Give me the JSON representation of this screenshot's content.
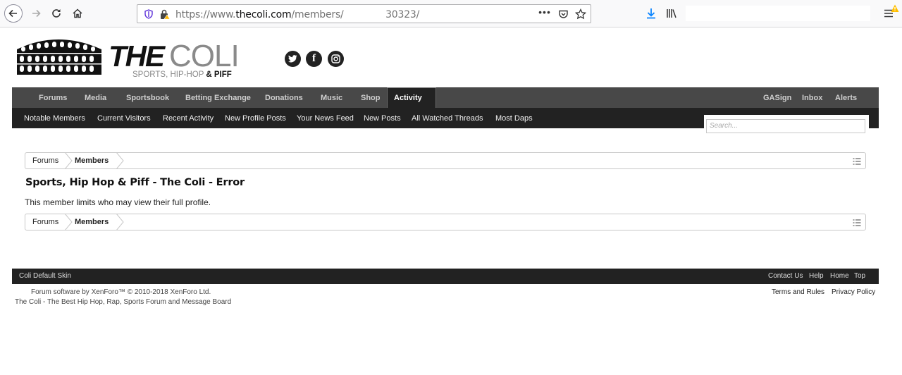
{
  "browser": {
    "url_prefix": "https://www.",
    "url_domain": "thecoli.com",
    "url_path": "/members/",
    "url_suffix": "30323/",
    "page_actions": "•••"
  },
  "site": {
    "logo_text": "THE COLI",
    "logo_the": "THE",
    "logo_coli": "COLI",
    "logo_sub": "SPORTS, HIP-HOP",
    "logo_piff": "& PIFF",
    "social": [
      "twitter-icon",
      "facebook-icon",
      "instagram-icon"
    ],
    "facebook_glyph": "f"
  },
  "nav": {
    "tabs": [
      "Forums",
      "Media",
      "Sportsbook",
      "Betting Exchange",
      "Donations",
      "Music",
      "Shop",
      "Activity"
    ],
    "active_tab": "Activity",
    "right": [
      "GASign",
      "Inbox",
      "Alerts"
    ],
    "sub": [
      "Notable Members",
      "Current Visitors",
      "Recent Activity",
      "New Profile Posts",
      "Your News Feed",
      "New Posts",
      "All Watched Threads",
      "Most Daps"
    ]
  },
  "search": {
    "placeholder": "Search..."
  },
  "breadcrumb": {
    "forums": "Forums",
    "members": "Members"
  },
  "error": {
    "title": "Sports, Hip Hop & Piff - The Coli - Error",
    "message": "This member limits who may view their full profile."
  },
  "footer": {
    "skin": "Coli Default Skin",
    "links": [
      "Contact Us",
      "Help",
      "Home",
      "Top"
    ],
    "copyright": "Forum software by XenForo™ © 2010-2018 XenForo Ltd.",
    "tagline": "The Coli - The Best Hip Hop, Rap, Sports Forum and Message Board",
    "terms": "Terms and Rules",
    "privacy": "Privacy Policy"
  },
  "colors": {
    "navbar": "#484848",
    "subnav": "#222222",
    "footer": "#222222"
  }
}
